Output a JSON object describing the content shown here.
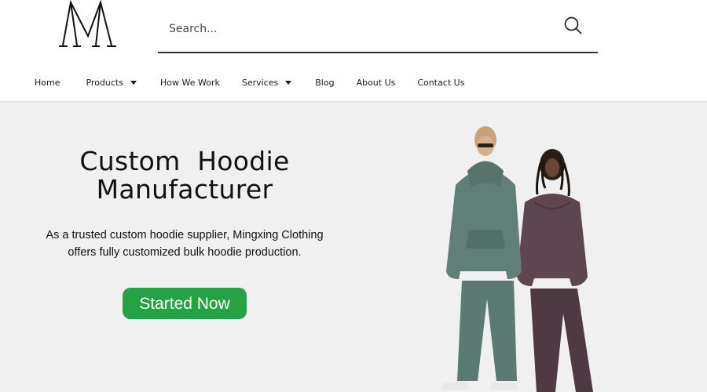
{
  "search": {
    "placeholder": "Search..."
  },
  "nav": {
    "items": [
      {
        "label": "Home",
        "has_dropdown": false
      },
      {
        "label": "Products",
        "has_dropdown": true
      },
      {
        "label": "How We Work",
        "has_dropdown": false
      },
      {
        "label": "Services",
        "has_dropdown": true
      },
      {
        "label": "Blog",
        "has_dropdown": false
      },
      {
        "label": "About Us",
        "has_dropdown": false
      },
      {
        "label": "Contact Us",
        "has_dropdown": false
      }
    ]
  },
  "hero": {
    "title_line1": "Custom  Hoodie",
    "title_line2": "Manufacturer",
    "desc_line1": "As a trusted custom hoodie supplier, Mingxing Clothing",
    "desc_line2": "offers fully customized bulk hoodie production.",
    "cta_label": "Started Now"
  },
  "icons": {
    "logo": "brand-logo-icon",
    "search": "search-icon",
    "dropdown": "caret-down-icon"
  },
  "colors": {
    "accent": "#25a244",
    "hero_bg": "#f0f0f0",
    "hoodie_left": "#5f7f78",
    "hoodie_right": "#5e4650"
  }
}
